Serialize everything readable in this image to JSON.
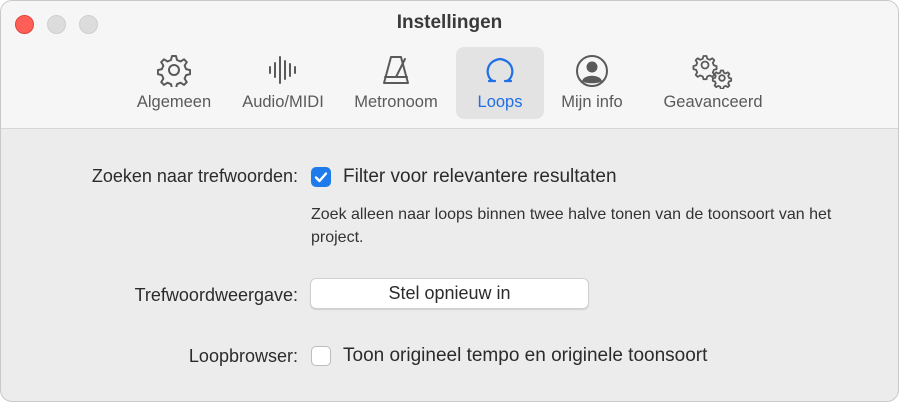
{
  "window": {
    "title": "Instellingen"
  },
  "tabs": [
    {
      "label": "Algemeen",
      "icon": "gear-icon",
      "active": false
    },
    {
      "label": "Audio/MIDI",
      "icon": "waveform-icon",
      "active": false
    },
    {
      "label": "Metronoom",
      "icon": "metronome-icon",
      "active": false
    },
    {
      "label": "Loops",
      "icon": "loop-icon",
      "active": true
    },
    {
      "label": "Mijn info",
      "icon": "person-circle-icon",
      "active": false
    },
    {
      "label": "Geavanceerd",
      "icon": "gears-icon",
      "active": false
    }
  ],
  "settings": {
    "keyword_search": {
      "label": "Zoeken naar trefwoorden:",
      "checkbox_label": "Filter voor relevantere resultaten",
      "checked": true,
      "description": "Zoek alleen naar loops binnen twee halve tonen van de toonsoort van het project."
    },
    "keyword_view": {
      "label": "Trefwoordweergave:",
      "button_label": "Stel opnieuw in"
    },
    "loop_browser": {
      "label": "Loopbrowser:",
      "checkbox_label": "Toon origineel tempo en originele toonsoort",
      "checked": false
    }
  },
  "colors": {
    "accent": "#1f7aec",
    "active_tab_text": "#1f6fe6",
    "close_button": "#ff5f57"
  }
}
